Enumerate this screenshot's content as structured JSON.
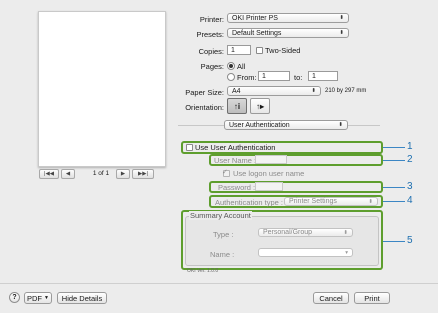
{
  "printer": {
    "label": "Printer:",
    "value": "OKI Printer PS"
  },
  "presets": {
    "label": "Presets:",
    "value": "Default Settings"
  },
  "copies": {
    "label": "Copies:",
    "value": "1",
    "two_sided_label": "Two-Sided"
  },
  "pages": {
    "label": "Pages:",
    "all_label": "All",
    "from_label": "From:",
    "from_value": "1",
    "to_label": "to:",
    "to_value": "1"
  },
  "paper_size": {
    "label": "Paper Size:",
    "value": "A4",
    "dimensions": "210 by 297 mm"
  },
  "orientation": {
    "label": "Orientation:",
    "portrait_glyph": "↑i",
    "landscape_glyph": "↑▸"
  },
  "panel_selector": {
    "value": "User Authentication"
  },
  "preview": {
    "page_text": "1 of 1",
    "first": "|◀◀",
    "prev": "◀",
    "next": "▶",
    "last": "▶▶|"
  },
  "auth": {
    "use_user_auth_label": "Use User Authentication",
    "user_name_label": "User Name :",
    "use_logon_label": "Use logon user name",
    "password_label": "Password :",
    "auth_type_label": "Authentication type :",
    "auth_type_value": "Printer Settings"
  },
  "summary": {
    "title": "Summary Account",
    "type_label": "Type :",
    "type_value": "Personal/Group",
    "name_label": "Name :",
    "name_value": "",
    "footer_text": "OKI Ver. 1.0.0"
  },
  "callouts": [
    "1",
    "2",
    "3",
    "4",
    "5"
  ],
  "bottom": {
    "help": "?",
    "pdf": "PDF",
    "hide_details": "Hide Details",
    "cancel": "Cancel",
    "print": "Print"
  },
  "colors": {
    "highlight": "#5e9e2e",
    "callout": "#1d6fb0"
  }
}
